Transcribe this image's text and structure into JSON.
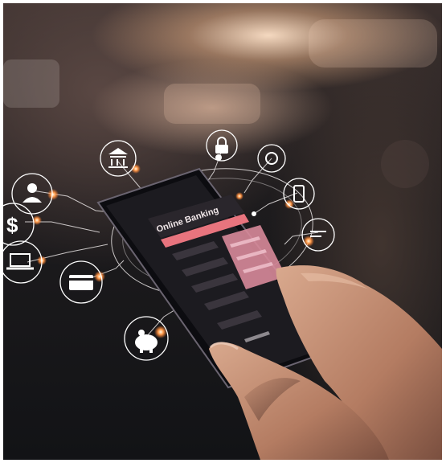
{
  "tablet": {
    "app_title": "Online Banking"
  },
  "icons": [
    "bank-icon",
    "lock-icon",
    "laptop-icon",
    "phone-icon",
    "person-icon",
    "dollar-icon",
    "laptop-icon",
    "credit-card-icon",
    "piggy-bank-icon",
    "chat-icon"
  ],
  "colors": {
    "accent": "#e8747e",
    "highlight": "#ffb16a",
    "screen": "#1c1b20",
    "glow": "#ffe0c8"
  }
}
